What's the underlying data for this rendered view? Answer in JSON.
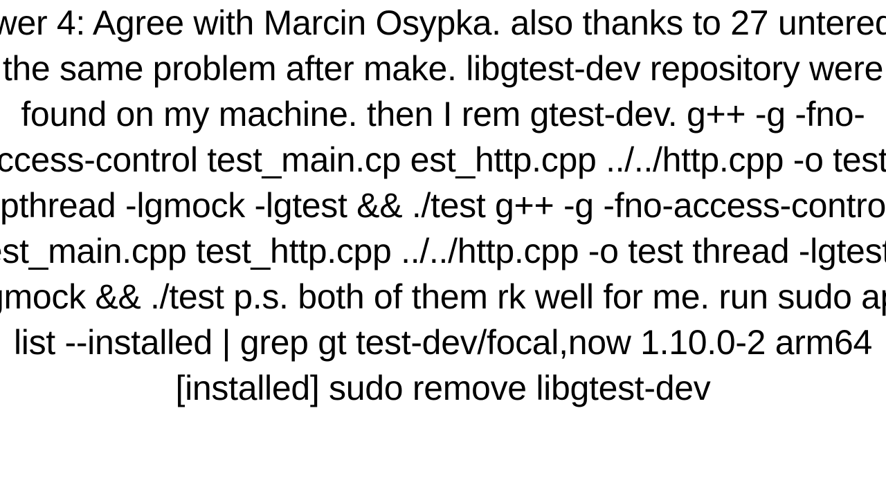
{
  "content": {
    "text": "wer 4: Agree with Marcin Osypka. also thanks to 27 untered the same problem after make. libgtest-dev  repository were found on my machine. then I rem gtest-dev. g++ -g -fno-access-control  test_main.cp est_http.cpp ../../http.cpp -o test  -lpthread -lgmock -lgtest  && ./test    g++ -g -fno-access-control  test_main.cpp test_http.cpp ../../http.cpp -o test  thread   -lgtest  -lgmock && ./test  p.s. both of them rk well for me. run sudo apt list --installed | grep gt test-dev/focal,now 1.10.0-2 arm64 [installed] sudo  remove libgtest-dev"
  }
}
